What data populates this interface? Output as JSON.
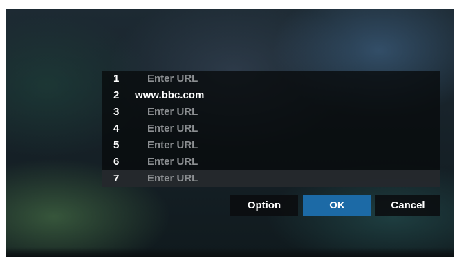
{
  "dialog": {
    "urls": [
      {
        "number": "1",
        "text": "Enter URL"
      },
      {
        "number": "2",
        "text": "www.bbc.com"
      },
      {
        "number": "3",
        "text": "Enter URL"
      },
      {
        "number": "4",
        "text": "Enter URL"
      },
      {
        "number": "5",
        "text": "Enter URL"
      },
      {
        "number": "6",
        "text": "Enter URL"
      },
      {
        "number": "7",
        "text": "Enter URL"
      }
    ],
    "selected_row": "7",
    "buttons": {
      "option_label": "Option",
      "ok_label": "OK",
      "cancel_label": "Cancel"
    },
    "focused_button": "OK"
  },
  "colors": {
    "focus_accent": "#1c6aa6",
    "placeholder_text": "#8c8f92",
    "value_text": "#ffffff"
  }
}
